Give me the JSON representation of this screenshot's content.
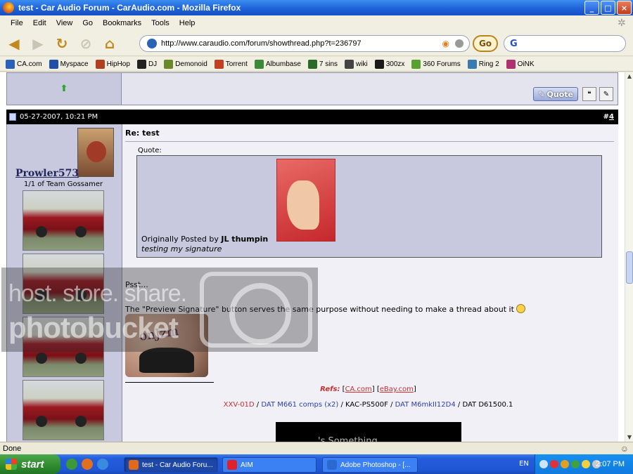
{
  "window": {
    "title": "test - Car Audio Forum - CarAudio.com - Mozilla Firefox",
    "buttons": {
      "minimize": "_",
      "maximize": "□",
      "close": "×"
    }
  },
  "menu": [
    "File",
    "Edit",
    "View",
    "Go",
    "Bookmarks",
    "Tools",
    "Help"
  ],
  "address": {
    "url": "http://www.caraudio.com/forum/showthread.php?t=236797",
    "go_label": "Go"
  },
  "search": {
    "engine_glyph": "G"
  },
  "bookmarks": [
    {
      "label": "CA.com",
      "color": "#2a62b8"
    },
    {
      "label": "Myspace",
      "color": "#1f4fa8"
    },
    {
      "label": "HipHop",
      "color": "#b04020"
    },
    {
      "label": "DJ",
      "color": "#222222"
    },
    {
      "label": "Demonoid",
      "color": "#6a8a2a"
    },
    {
      "label": "Torrent",
      "color": "#c04020"
    },
    {
      "label": "Albumbase",
      "color": "#3a8a3a"
    },
    {
      "label": "7 sins",
      "color": "#2a6a2a"
    },
    {
      "label": "wiki",
      "color": "#444444"
    },
    {
      "label": "300zx",
      "color": "#1a1a1a"
    },
    {
      "label": "360 Forums",
      "color": "#58a030"
    },
    {
      "label": "Ring 2",
      "color": "#3a7ab0"
    },
    {
      "label": "OiNK",
      "color": "#b03070"
    }
  ],
  "prev_post": {
    "quote_label": "Quote"
  },
  "post": {
    "date": "05-27-2007, 10:21 PM",
    "number_prefix": "#",
    "number": "4",
    "user": {
      "name": "Prowler573",
      "title": "1/1 of Team Gossamer"
    },
    "subject": "Re: test",
    "quote": {
      "label": "Quote:",
      "originally_posted_by": "Originally Posted by",
      "author": "JL thumpin",
      "text": "testing my signature"
    },
    "body_line1": "Psst...",
    "body_line2": "The \"Preview Signature\" button serves the same purpose without needing to make a thread about it",
    "sig_ink": "onJzm",
    "refs": {
      "label": "Refs:",
      "link1": "CA.com",
      "link2": "eBay.com"
    },
    "gear": [
      {
        "text": "XXV-01D",
        "color": "red"
      },
      {
        "text": " / ",
        "color": "black"
      },
      {
        "text": "DAT M661 comps (x2)",
        "color": "blue"
      },
      {
        "text": " / KAC-PS500F / ",
        "color": "black"
      },
      {
        "text": "DAT M6mkII12D4",
        "color": "blue"
      },
      {
        "text": " / DAT D61500.1",
        "color": "black"
      }
    ],
    "banner_text": "'s Something"
  },
  "watermark": {
    "line1": "host. store. share.",
    "line2": "photobucket"
  },
  "status": {
    "text": "Done"
  },
  "taskbar": {
    "start": "start",
    "tasks": [
      {
        "label": "test - Car Audio Foru...",
        "active": true,
        "color": "#e06a1a"
      },
      {
        "label": "AIM",
        "active": false,
        "color": "#e0202a"
      },
      {
        "label": "Adobe Photoshop - [...",
        "active": false,
        "color": "#2a6ad0"
      }
    ],
    "lang": "EN",
    "clock": "2:07 PM"
  }
}
